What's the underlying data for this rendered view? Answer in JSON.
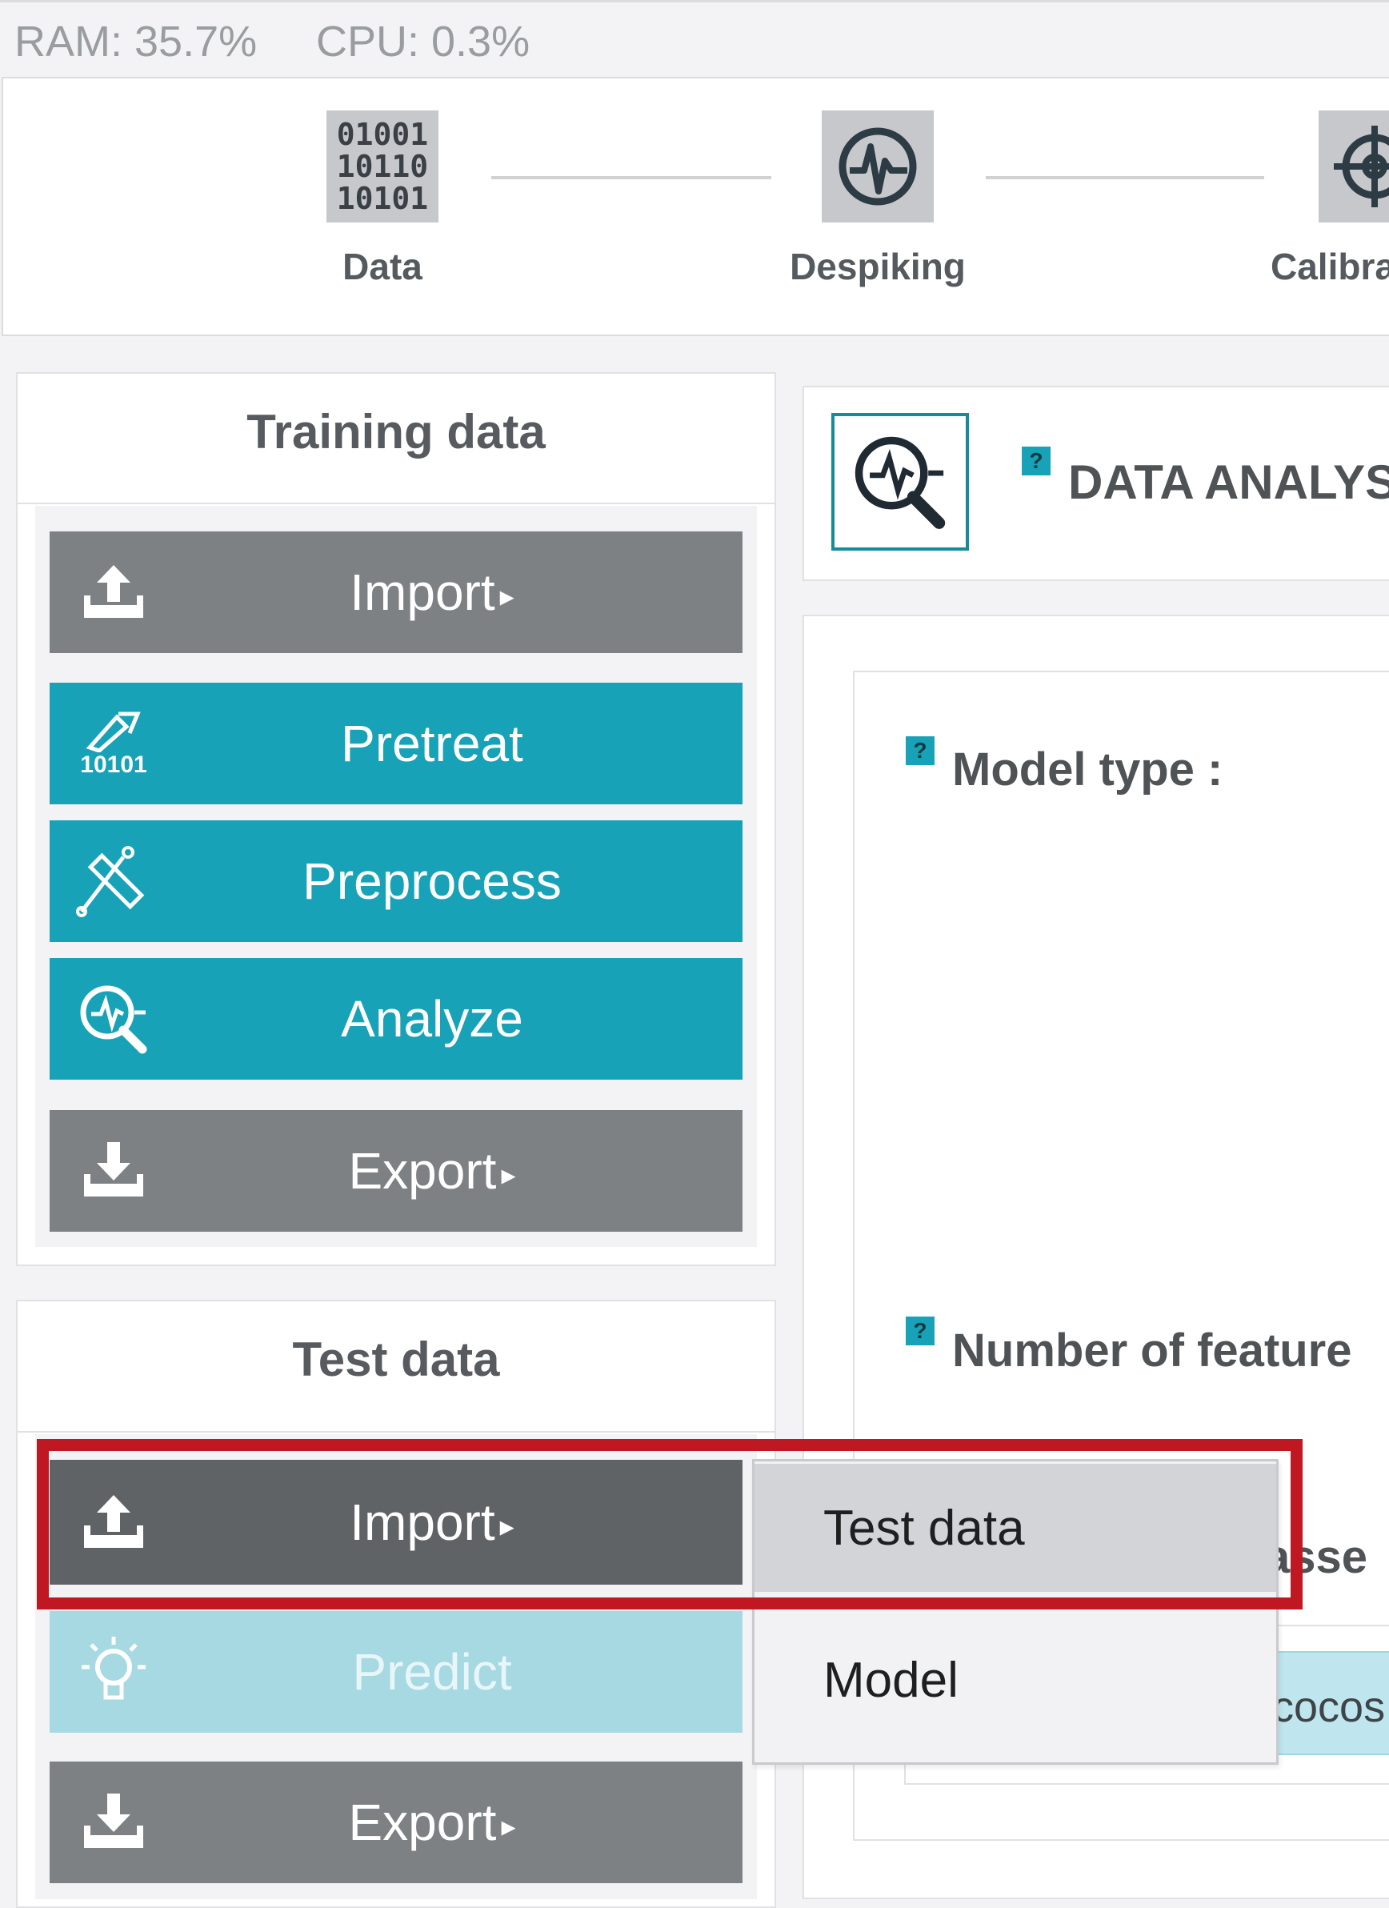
{
  "status": {
    "ram": "RAM: 35.7%",
    "cpu": "CPU: 0.3%"
  },
  "stepper": {
    "steps": [
      {
        "label": "Data",
        "icon": "binary-data-icon",
        "icon_text": [
          "01001",
          "10110",
          "10101"
        ]
      },
      {
        "label": "Despiking",
        "icon": "despiking-icon"
      },
      {
        "label": "Calibra",
        "icon": "calibration-crosshair-icon"
      }
    ]
  },
  "training": {
    "title": "Training data",
    "buttons": {
      "import": "Import",
      "pretreat": "Pretreat",
      "pretreat_icon_text": "10101",
      "preprocess": "Preprocess",
      "analyze": "Analyze",
      "export": "Export"
    }
  },
  "test": {
    "title": "Test data",
    "buttons": {
      "import": "Import",
      "predict": "Predict",
      "export": "Export"
    }
  },
  "analysis": {
    "help": "?",
    "title": "DATA ANALYS",
    "model_type_label": "Model type :",
    "num_features_label": "Number of feature",
    "classes_label": "asse",
    "classes_chip": "cocos"
  },
  "dropdown": {
    "items": [
      "Test data",
      "Model"
    ]
  },
  "colors": {
    "accent": "#17a2b8",
    "gray_button": "#7d8184",
    "highlight": "#c01822"
  }
}
